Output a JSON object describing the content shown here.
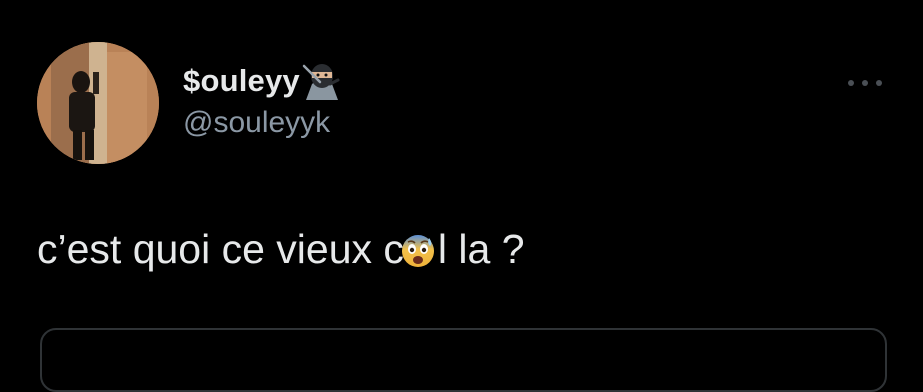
{
  "tweet": {
    "author": {
      "display_name": "$ouleyy",
      "handle": "@souleyyk",
      "name_emoji_icon": "ninja-icon",
      "avatar_icon": "profile-avatar"
    },
    "text_before_emoji": "c’est quoi ce vieux c",
    "text_after_emoji": "l la ?",
    "text_emoji_icon": "anxious-face-with-sweat-icon",
    "more_icon": "more-horizontal-icon"
  },
  "colors": {
    "background": "#000000",
    "text_primary": "#e7e9ea",
    "text_secondary": "#8b98a5",
    "border": "#2f3336"
  }
}
